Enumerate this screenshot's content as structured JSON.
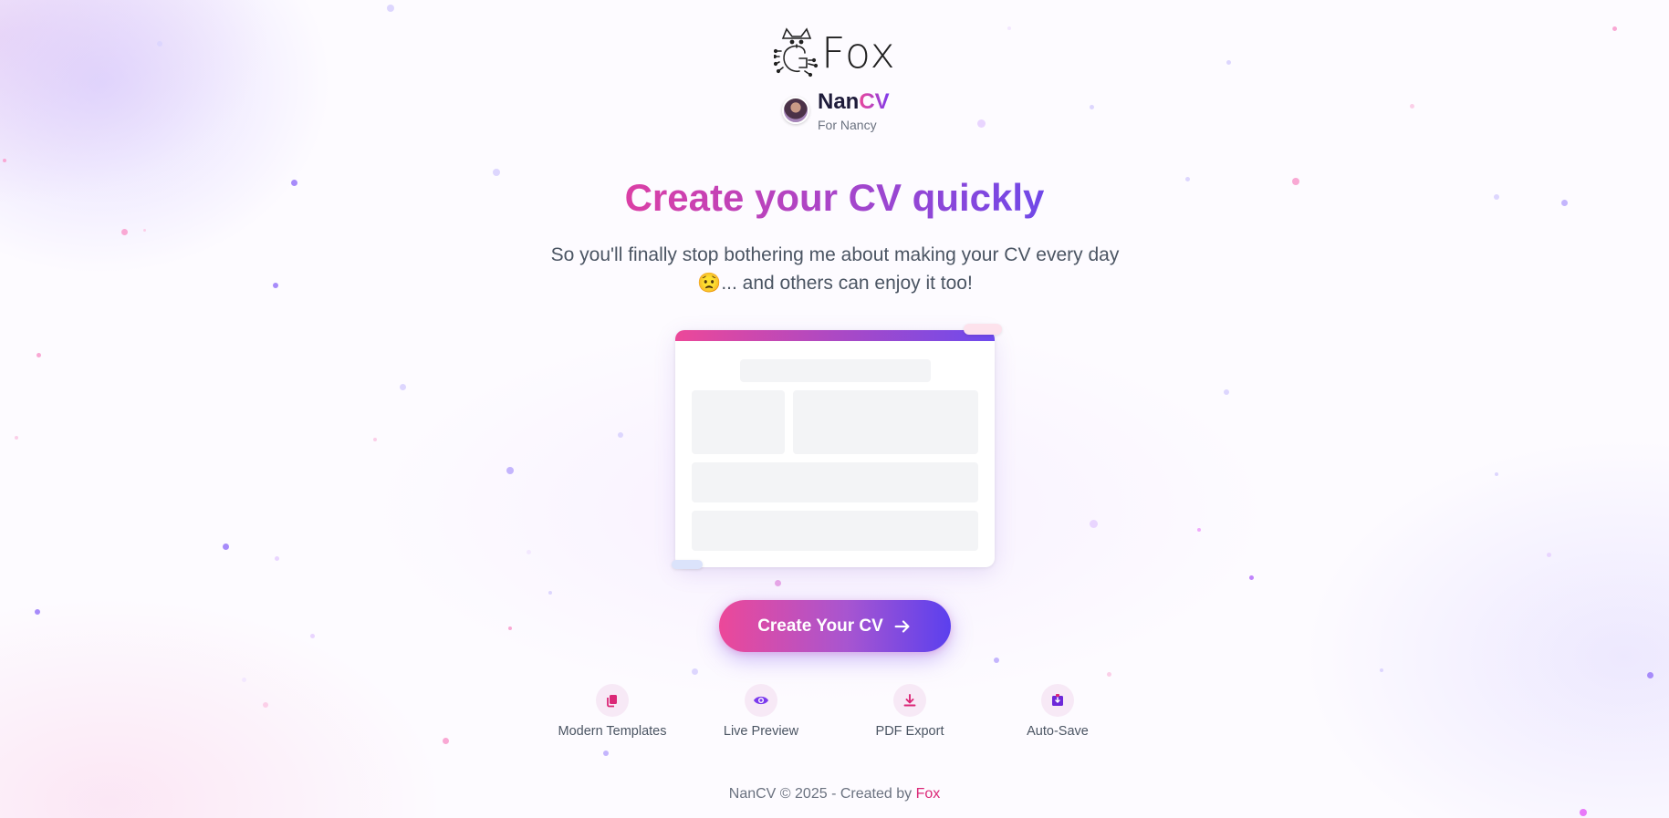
{
  "logo": {
    "text": "Fox",
    "icon": "fox-circuit-icon"
  },
  "brand": {
    "name_prefix": "Nan",
    "name_suffix": "CV",
    "subtitle": "For Nancy"
  },
  "hero": {
    "title": "Create your CV quickly",
    "subtitle": "So you'll finally stop bothering me about making your CV every day 😟... and others can enjoy it too!"
  },
  "cta": {
    "label": "Create Your CV",
    "icon": "arrow-right-icon"
  },
  "features": [
    {
      "label": "Modern Templates",
      "icon": "copy-icon"
    },
    {
      "label": "Live Preview",
      "icon": "eye-icon"
    },
    {
      "label": "PDF Export",
      "icon": "download-icon"
    },
    {
      "label": "Auto-Save",
      "icon": "save-icon"
    }
  ],
  "footer": {
    "text": "NanCV © 2025 - Created by",
    "link": "Fox"
  },
  "colors": {
    "pink": "#ec4899",
    "purple": "#7c3aed",
    "indigo": "#5b40ee"
  }
}
